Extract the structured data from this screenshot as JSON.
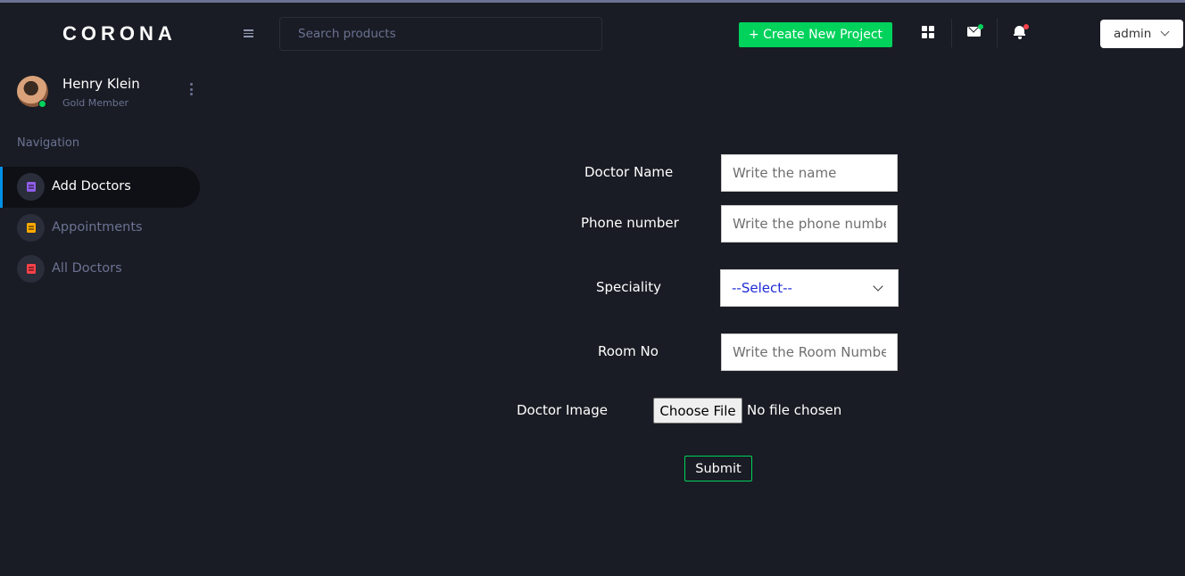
{
  "brand": {
    "name": "CORONA"
  },
  "profile": {
    "name": "Henry Klein",
    "role": "Gold Member",
    "status_color": "#00d25b"
  },
  "sidebar": {
    "heading": "Navigation",
    "items": [
      {
        "label": "Add Doctors",
        "icon": "document-icon",
        "color": "#8f5fe8",
        "active": true
      },
      {
        "label": "Appointments",
        "icon": "document-icon",
        "color": "#ffab00",
        "active": false
      },
      {
        "label": "All Doctors",
        "icon": "document-icon",
        "color": "#fc424a",
        "active": false
      }
    ]
  },
  "topbar": {
    "search_placeholder": "Search products",
    "create_label": "+ Create New Project",
    "user_menu_label": "admin",
    "icons": [
      "menu-icon",
      "grid-icon",
      "mail-icon",
      "bell-icon"
    ]
  },
  "form": {
    "doctor_name": {
      "label": "Doctor Name",
      "placeholder": "Write the name"
    },
    "phone": {
      "label": "Phone number",
      "placeholder": "Write the phone number"
    },
    "speciality": {
      "label": "Speciality",
      "selected": "--Select--"
    },
    "room": {
      "label": "Room No",
      "placeholder": "Write the Room Number"
    },
    "image": {
      "label": "Doctor Image",
      "button": "Choose File",
      "status": "No file chosen"
    },
    "submit_label": "Submit"
  },
  "colors": {
    "accent_success": "#00d25b",
    "accent_info": "#0090e7",
    "accent_danger": "#fc424a",
    "background": "#191c24"
  }
}
